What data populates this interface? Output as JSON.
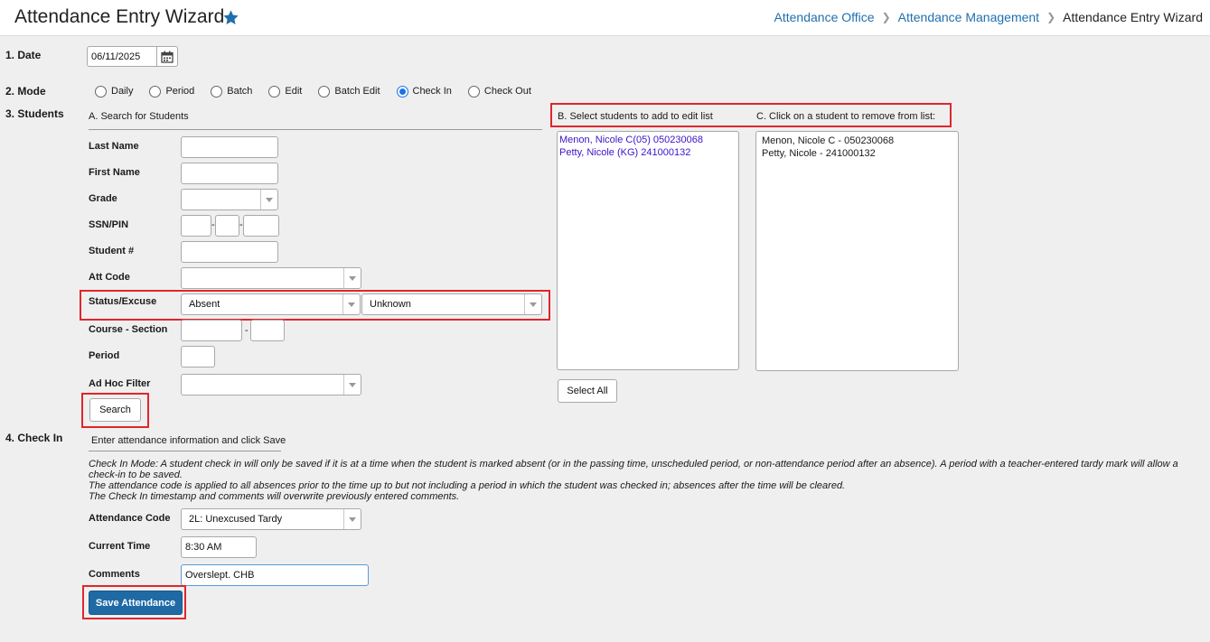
{
  "header": {
    "title": "Attendance Entry Wizard",
    "breadcrumb": [
      "Attendance Office",
      "Attendance Management",
      "Attendance Entry Wizard"
    ]
  },
  "steps": {
    "date": "1. Date",
    "mode": "2. Mode",
    "students": "3. Students",
    "checkin": "4. Check In"
  },
  "date": {
    "value": "06/11/2025"
  },
  "modes": [
    "Daily",
    "Period",
    "Batch",
    "Edit",
    "Batch Edit",
    "Check In",
    "Check Out"
  ],
  "selected_mode": "Check In",
  "search": {
    "heading": "A. Search for Students",
    "last_name_label": "Last Name",
    "first_name_label": "First Name",
    "grade_label": "Grade",
    "ssn_label": "SSN/PIN",
    "student_num_label": "Student #",
    "att_code_label": "Att Code",
    "status_excuse_label": "Status/Excuse",
    "status_value": "Absent",
    "excuse_value": "Unknown",
    "course_section_label": "Course - Section",
    "course_sep": "-",
    "period_label": "Period",
    "adhoc_label": "Ad Hoc Filter",
    "search_button": "Search"
  },
  "select_list": {
    "heading": "B. Select students to add to edit list",
    "items": [
      "Menon, Nicole C(05) 050230068",
      "Petty, Nicole (KG) 241000132"
    ],
    "select_all_button": "Select All"
  },
  "edit_list": {
    "heading": "C. Click on a student to remove from list:",
    "items": [
      "Menon, Nicole C - 050230068",
      "Petty, Nicole - 241000132"
    ]
  },
  "checkin": {
    "heading": "Enter attendance information and click Save",
    "notes": [
      "Check In Mode: A student check in will only be saved if it is at a time when the student is marked absent (or in the passing time, unscheduled period, or non-attendance period after an absence). A period with a teacher-entered tardy mark will allow a check-in to be saved.",
      "The attendance code is applied to all absences prior to the time up to but not including a period in which the student was checked in; absences after the time will be cleared.",
      "The Check In timestamp and comments will overwrite previously entered comments."
    ],
    "attendance_code_label": "Attendance Code",
    "attendance_code_value": "2L: Unexcused Tardy",
    "current_time_label": "Current Time",
    "current_time_value": "8:30 AM",
    "comments_label": "Comments",
    "comments_value": "Overslept. CHB",
    "save_button": "Save Attendance"
  }
}
